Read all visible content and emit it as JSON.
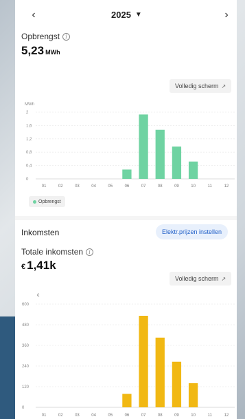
{
  "nav": {
    "prev_icon": "chevron-left-icon",
    "next_icon": "chevron-right-icon",
    "year": "2025",
    "caret_icon": "caret-down-icon"
  },
  "yield": {
    "label": "Opbrengst",
    "value": "5,23",
    "unit": "MWh",
    "fullscreen_label": "Volledig scherm"
  },
  "income": {
    "section_title": "Inkomsten",
    "price_button": "Elektr.prijzen instellen",
    "total_label": "Totale inkomsten",
    "currency": "€",
    "value": "1,41k",
    "fullscreen_label": "Volledig scherm"
  },
  "colors": {
    "yield_bar": "#6fd3a2",
    "income_bar": "#f1b813",
    "accent_blue": "#2462c9"
  },
  "chart_data": [
    {
      "type": "bar",
      "title": "",
      "ylabel": "MWh",
      "xlabel": "",
      "categories": [
        "01",
        "02",
        "03",
        "04",
        "05",
        "06",
        "07",
        "08",
        "09",
        "10",
        "11",
        "12"
      ],
      "series": [
        {
          "name": "Opbrengst",
          "values": [
            0,
            0,
            0,
            0,
            0,
            0.28,
            1.93,
            1.47,
            0.97,
            0.52,
            0,
            0
          ]
        }
      ],
      "ylim": [
        0,
        2
      ],
      "yticks": [
        "0",
        "0,4",
        "0,8",
        "1,2",
        "1,6",
        "2"
      ],
      "grid": true,
      "legend": "bottom-left"
    },
    {
      "type": "bar",
      "title": "",
      "ylabel": "€",
      "xlabel": "",
      "categories": [
        "01",
        "02",
        "03",
        "04",
        "05",
        "06",
        "07",
        "08",
        "09",
        "10",
        "11",
        "12"
      ],
      "series": [
        {
          "values": [
            0,
            0,
            0,
            0,
            0,
            78,
            532,
            405,
            265,
            140,
            0,
            0
          ]
        }
      ],
      "ylim": [
        0,
        600
      ],
      "yticks": [
        "0",
        "120",
        "240",
        "360",
        "480",
        "600"
      ],
      "grid": true
    }
  ]
}
